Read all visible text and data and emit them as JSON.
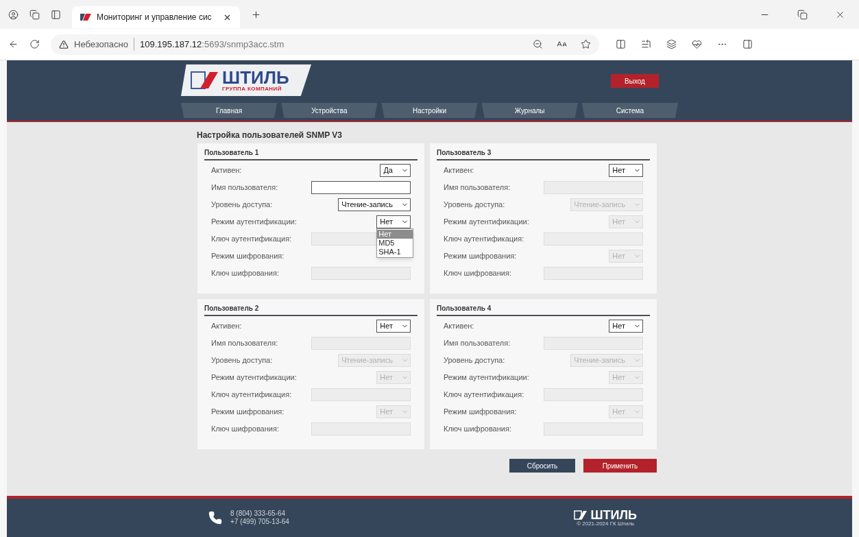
{
  "browser": {
    "tab_title": "Мониторинг и управление сис",
    "address": {
      "warning": "Небезопасно",
      "host": "109.195.187.12",
      "rest": ":5693/snmp3acc.stm"
    }
  },
  "header": {
    "logo": {
      "text": "ШТИЛЬ",
      "subtitle": "ГРУППА КОМПАНИЙ"
    },
    "logout": "Выход",
    "nav": [
      "Главная",
      "Устройства",
      "Настройки",
      "Журналы",
      "Система"
    ]
  },
  "page_title": "Настройка пользователей SNMP V3",
  "users": [
    {
      "title": "Пользователь 1",
      "fields": [
        {
          "kind": "select",
          "label": "Активен:",
          "value": "Да",
          "disabled": false
        },
        {
          "kind": "input",
          "label": "Имя пользователя:",
          "disabled": false
        },
        {
          "kind": "select",
          "label": "Уровень доступа:",
          "value": "Чтение-запись",
          "disabled": false
        },
        {
          "kind": "select",
          "label": "Режим аутентификации:",
          "value": "Нет",
          "disabled": false,
          "options": [
            {
              "label": "Нет",
              "selected": true
            },
            {
              "label": "MD5",
              "selected": false
            },
            {
              "label": "SHA-1",
              "selected": false
            }
          ]
        },
        {
          "kind": "input",
          "label": "Ключ аутентификация:",
          "disabled": true
        },
        {
          "kind": "select",
          "label": "Режим шифрования:"
        },
        {
          "kind": "input",
          "label": "Ключ шифрования:",
          "disabled": true
        }
      ]
    },
    {
      "title": "Пользователь 3",
      "fields": [
        {
          "kind": "select",
          "label": "Активен:",
          "value": "Нет",
          "disabled": false
        },
        {
          "kind": "input",
          "label": "Имя пользователя:",
          "disabled": true
        },
        {
          "kind": "select",
          "label": "Уровень доступа:",
          "value": "Чтение-запись",
          "disabled": true
        },
        {
          "kind": "select",
          "label": "Режим аутентификации:",
          "value": "Нет",
          "disabled": true
        },
        {
          "kind": "input",
          "label": "Ключ аутентификация:",
          "disabled": true
        },
        {
          "kind": "select",
          "label": "Режим шифрования:",
          "value": "Нет",
          "disabled": true
        },
        {
          "kind": "input",
          "label": "Ключ шифрования:",
          "disabled": true
        }
      ]
    },
    {
      "title": "Пользователь 2",
      "fields": [
        {
          "kind": "select",
          "label": "Активен:",
          "value": "Нет",
          "disabled": false
        },
        {
          "kind": "input",
          "label": "Имя пользователя:",
          "disabled": true
        },
        {
          "kind": "select",
          "label": "Уровень доступа:",
          "value": "Чтение-запись",
          "disabled": true
        },
        {
          "kind": "select",
          "label": "Режим аутентификации:",
          "value": "Нет",
          "disabled": true
        },
        {
          "kind": "input",
          "label": "Ключ аутентификация:",
          "disabled": true
        },
        {
          "kind": "select",
          "label": "Режим шифрования:",
          "value": "Нет",
          "disabled": true
        },
        {
          "kind": "input",
          "label": "Ключ шифрования:",
          "disabled": true
        }
      ]
    },
    {
      "title": "Пользователь 4",
      "fields": [
        {
          "kind": "select",
          "label": "Активен:",
          "value": "Нет",
          "disabled": false
        },
        {
          "kind": "input",
          "label": "Имя пользователя:",
          "disabled": true
        },
        {
          "kind": "select",
          "label": "Уровень доступа:",
          "value": "Чтение-запись",
          "disabled": true
        },
        {
          "kind": "select",
          "label": "Режим аутентификации:",
          "value": "Нет",
          "disabled": true
        },
        {
          "kind": "input",
          "label": "Ключ аутентификация:",
          "disabled": true
        },
        {
          "kind": "select",
          "label": "Режим шифрования:",
          "value": "Нет",
          "disabled": true
        },
        {
          "kind": "input",
          "label": "Ключ шифрования:",
          "disabled": true
        }
      ]
    }
  ],
  "buttons": {
    "reset": "Сбросить",
    "apply": "Применить"
  },
  "footer": {
    "phones": [
      "8 (804) 333-65-64",
      "+7 (499) 705-13-64"
    ],
    "logo": "ШТИЛЬ",
    "copyright": "© 2021-2024 ГК Штиль"
  }
}
